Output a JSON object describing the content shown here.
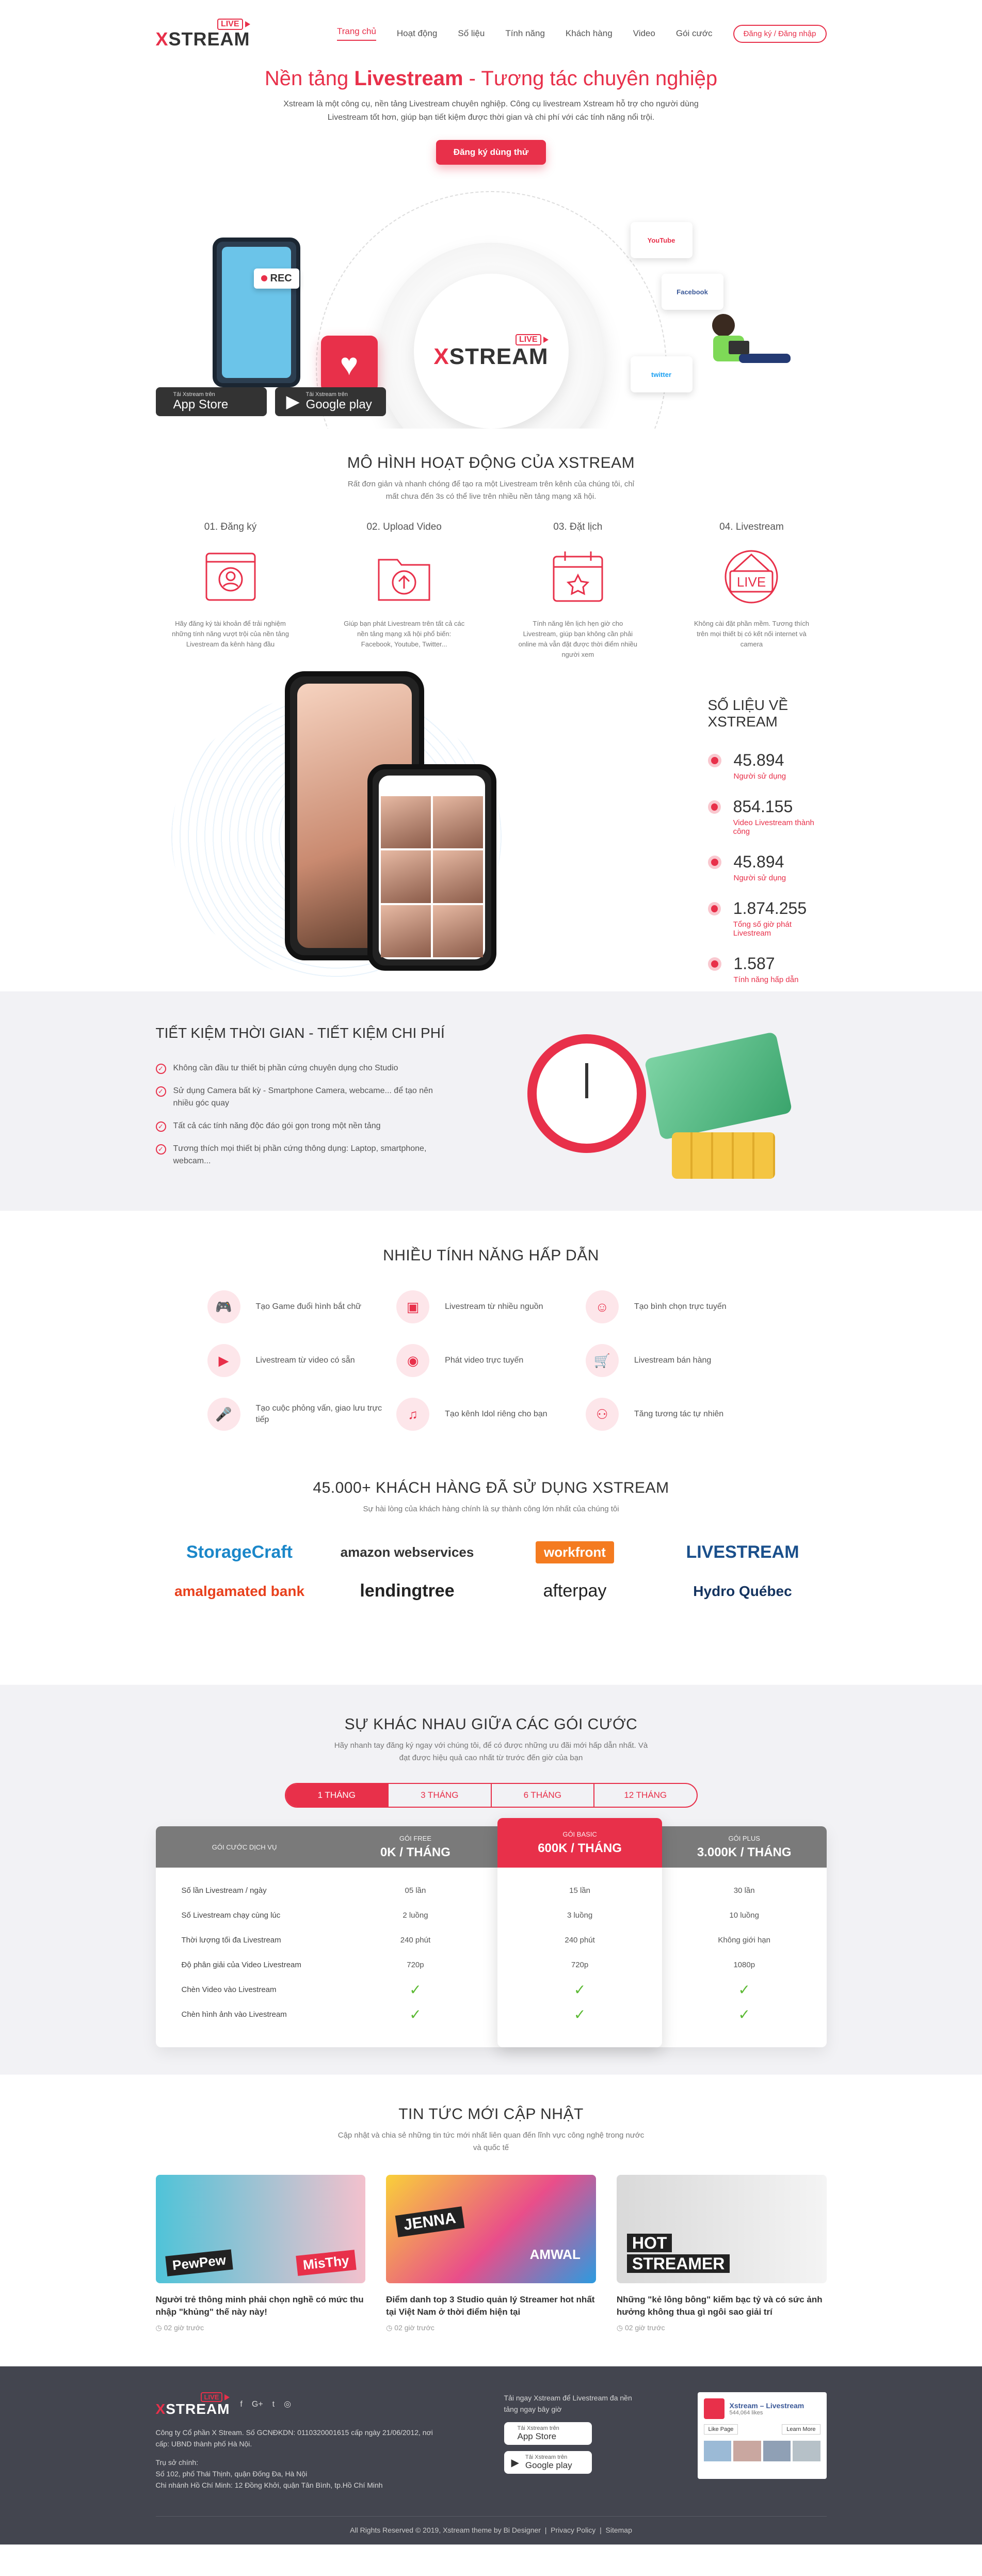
{
  "brand": {
    "live": "LIVE",
    "name_pre": "X",
    "name_post": "STREAM"
  },
  "nav": {
    "items": [
      "Trang chủ",
      "Hoạt động",
      "Số liệu",
      "Tính năng",
      "Khách hàng",
      "Video",
      "Gói cước"
    ],
    "login": "Đăng ký / Đăng nhập"
  },
  "hero": {
    "title_pre": "Nền tảng ",
    "title_bold": "Livestream",
    "title_post": " - Tương tác chuyên nghiệp",
    "desc": "Xstream là một công cụ, nền tảng Livestream chuyên nghiệp. Công cụ livestream Xstream hỗ trợ cho người dùng Livestream tốt hơn, giúp bạn tiết kiệm được thời gian và chi phí với các tính năng nổi trội.",
    "cta": "Đăng ký dùng thử",
    "rec": "REC",
    "social": [
      "YouTube",
      "Facebook",
      "twitter"
    ],
    "appstore_small": "Tải Xstream trên",
    "appstore": "App Store",
    "googleplay_small": "Tải Xstream trên",
    "googleplay": "Google play"
  },
  "model": {
    "title": "MÔ HÌNH HOẠT ĐỘNG CỦA XSTREAM",
    "sub": "Rất đơn giản và nhanh chóng để tạo ra một Livestream trên kênh của chúng tôi, chỉ mất chưa đến 3s có thể live trên nhiều nền tảng mạng xã hội.",
    "steps": [
      {
        "num": "01. Đăng ký",
        "icon": "user-register-icon",
        "text": "Hãy đăng ký tài khoản để trải nghiệm những tính năng vượt trội của nền tảng Livestream đa kênh hàng đầu"
      },
      {
        "num": "02. Upload Video",
        "icon": "upload-folder-icon",
        "text": "Giúp bạn phát Livestream trên tất cả các nền tảng mạng xã hội phổ biến: Facebook, Youtube, Twitter..."
      },
      {
        "num": "03. Đặt lịch",
        "icon": "calendar-icon",
        "text": "Tính năng lên lịch hẹn giờ cho Livestream, giúp bạn không cần phải online mà vẫn đặt được thời điểm nhiều người xem"
      },
      {
        "num": "04. Livestream",
        "icon": "live-badge-icon",
        "text": "Không cài đặt phần mềm. Tương thích trên mọi thiết bị có kết nối internet và camera"
      }
    ]
  },
  "stats": {
    "title": "SỐ LIỆU VỀ XSTREAM",
    "items": [
      {
        "n": "45.894",
        "l": "Người sử dụng"
      },
      {
        "n": "854.155",
        "l": "Video Livestream thành công"
      },
      {
        "n": "45.894",
        "l": "Người sử dụng"
      },
      {
        "n": "1.874.255",
        "l": "Tổng số giờ phát Livestream"
      },
      {
        "n": "1.587",
        "l": "Tính năng hấp dẫn"
      }
    ]
  },
  "save": {
    "title": "TIẾT KIỆM THỜI GIAN - TIẾT KIỆM CHI PHÍ",
    "items": [
      "Không cần đầu tư thiết bị phần cứng chuyên dụng cho Studio",
      "Sử dụng Camera bất kỳ - Smartphone Camera, webcame... để tạo nên nhiều góc quay",
      "Tất cả các tính năng độc đáo gói gọn trong một nền tảng",
      "Tương thích mọi thiết bị phần cứng thông dụng: Laptop, smartphone, webcam..."
    ]
  },
  "features": {
    "title": "NHIỀU TÍNH NĂNG HẤP DẪN",
    "items": [
      {
        "label": "Tạo Game đuổi hình bắt chữ",
        "icon": "game-icon"
      },
      {
        "label": "Livestream từ nhiều nguồn",
        "icon": "multi-source-icon"
      },
      {
        "label": "Tạo bình chọn trực tuyến",
        "icon": "vote-icon"
      },
      {
        "label": "Livestream từ video có sẵn",
        "icon": "video-file-icon"
      },
      {
        "label": "Phát video trực tuyến",
        "icon": "broadcast-icon"
      },
      {
        "label": "Livestream bán hàng",
        "icon": "cart-icon"
      },
      {
        "label": "Tạo cuộc phỏng vấn, giao lưu trực tiếp",
        "icon": "microphone-icon"
      },
      {
        "label": "Tạo kênh Idol riêng cho bạn",
        "icon": "music-icon"
      },
      {
        "label": "Tăng tương tác tự nhiên",
        "icon": "network-icon"
      }
    ]
  },
  "customers": {
    "title": "45.000+ KHÁCH HÀNG ĐÃ SỬ DỤNG XSTREAM",
    "sub": "Sự hài lòng của khách hàng chính là sự thành công lớn nhất của chúng tôi",
    "logos": [
      "StorageCraft",
      "amazon webservices",
      "workfront",
      "LIVESTREAM",
      "amalgamated bank",
      "lendingtree",
      "afterpay",
      "Hydro Québec"
    ]
  },
  "pricing": {
    "title": "SỰ KHÁC NHAU GIỮA CÁC GÓI CƯỚC",
    "sub": "Hãy nhanh tay đăng ký ngay với chúng tôi, để có được những ưu đãi mới hấp dẫn nhất. Và đạt được hiệu quả cao nhất từ trước đến giờ của bạn",
    "tabs": [
      "1 THÁNG",
      "3 THÁNG",
      "6 THÁNG",
      "12 THÁNG"
    ],
    "col_label": "GÓI CƯỚC DỊCH VỤ",
    "rows": [
      "Số lần Livestream / ngày",
      "Số Livestream chạy cùng lúc",
      "Thời lượng tối đa Livestream",
      "Độ phân giải của Video Livestream",
      "Chèn Video vào Livestream",
      "Chèn hình ảnh vào Livestream"
    ],
    "plans": [
      {
        "name": "GÓI FREE",
        "price": "0K / THÁNG",
        "values": [
          "05 lần",
          "2 luồng",
          "240 phút",
          "720p",
          "✓",
          "✓"
        ]
      },
      {
        "name": "GÓI BASIC",
        "price": "600K / THÁNG",
        "values": [
          "15 lần",
          "3 luồng",
          "240 phút",
          "720p",
          "✓",
          "✓"
        ]
      },
      {
        "name": "GÓI PLUS",
        "price": "3.000K / THÁNG",
        "values": [
          "30 lần",
          "10 luồng",
          "Không giới hạn",
          "1080p",
          "✓",
          "✓"
        ]
      }
    ]
  },
  "news": {
    "title": "TIN TỨC MỚI CẬP NHẬT",
    "sub": "Cập nhật và chia sẻ những tin tức mới nhất liên quan đến lĩnh vực công nghệ trong nước và quốc tế",
    "items": [
      {
        "title": "Người trẻ thông minh phải chọn nghề có mức thu nhập \"khủng\" thế này này!",
        "date": "02 giờ trước",
        "tags": [
          "PewPew",
          "MisThy"
        ]
      },
      {
        "title": "Điểm danh top 3 Studio quản lý Streamer hot nhất tại Việt Nam ở thời điểm hiện tại",
        "date": "02 giờ trước",
        "tags": [
          "JENNA",
          "AMWAL"
        ]
      },
      {
        "title": "Những \"kẻ lông bông\" kiếm bạc tỷ và có sức ảnh hưởng không thua gì ngôi sao giải trí",
        "date": "02 giờ trước",
        "tags": [
          "HOT",
          "STREAMER"
        ]
      }
    ]
  },
  "footer": {
    "company": "Công ty Cổ phần X Stream. Số GCNĐKDN: 0110320001615 cấp ngày 21/06/2012, nơi cấp: UBND thành phố Hà Nội.",
    "hq_label": "Trụ sở chính:",
    "hq": "Số 102, phố Thái Thịnh, quận Đống Đa, Hà Nội",
    "branch": "Chi nhánh Hồ Chí Minh: 12 Đồng Khởi, quận Tân Bình, tp.Hồ Chí Minh",
    "download": "Tải ngay Xstream để Livestream đa nền tảng ngay bây giờ",
    "fb_name": "Xstream – Livestream",
    "fb_likes": "544,064 likes",
    "fb_like_btn": "Like Page",
    "fb_more": "Learn More",
    "copyright": "All Rights Reserved © 2019, Xstream theme by Bi Designer",
    "privacy": "Privacy Policy",
    "sitemap": "Sitemap"
  }
}
